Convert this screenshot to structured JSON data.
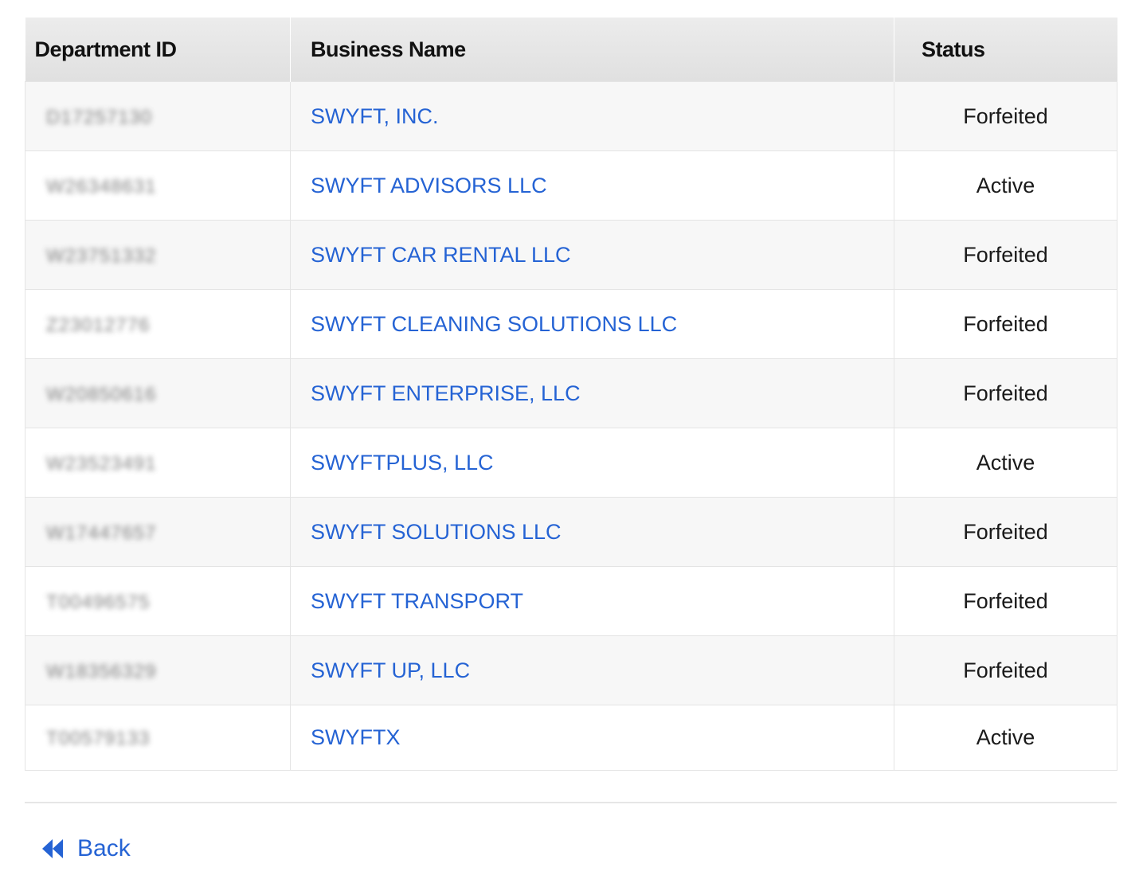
{
  "table": {
    "headers": {
      "department_id": "Department ID",
      "business_name": "Business Name",
      "status": "Status"
    },
    "rows": [
      {
        "department_id": "D17257130",
        "business_name": "SWYFT, INC.",
        "status": "Forfeited"
      },
      {
        "department_id": "W26348631",
        "business_name": "SWYFT ADVISORS LLC",
        "status": "Active"
      },
      {
        "department_id": "W23751332",
        "business_name": "SWYFT CAR RENTAL LLC",
        "status": "Forfeited"
      },
      {
        "department_id": "Z23012776",
        "business_name": "SWYFT CLEANING SOLUTIONS LLC",
        "status": "Forfeited"
      },
      {
        "department_id": "W20850616",
        "business_name": "SWYFT ENTERPRISE, LLC",
        "status": "Forfeited"
      },
      {
        "department_id": "W23523491",
        "business_name": "SWYFTPLUS, LLC",
        "status": "Active"
      },
      {
        "department_id": "W17447657",
        "business_name": "SWYFT SOLUTIONS LLC",
        "status": "Forfeited"
      },
      {
        "department_id": "T00496575",
        "business_name": "SWYFT TRANSPORT",
        "status": "Forfeited"
      },
      {
        "department_id": "W18356329",
        "business_name": "SWYFT UP, LLC",
        "status": "Forfeited"
      },
      {
        "department_id": "T00579133",
        "business_name": "SWYFTX",
        "status": "Active"
      }
    ]
  },
  "footer": {
    "back_label": "Back",
    "back_icon": "double-chevron-left-icon"
  },
  "colors": {
    "link": "#2563d4",
    "header_bg": "#e5e5e5",
    "row_alt_bg": "#f7f7f7"
  }
}
